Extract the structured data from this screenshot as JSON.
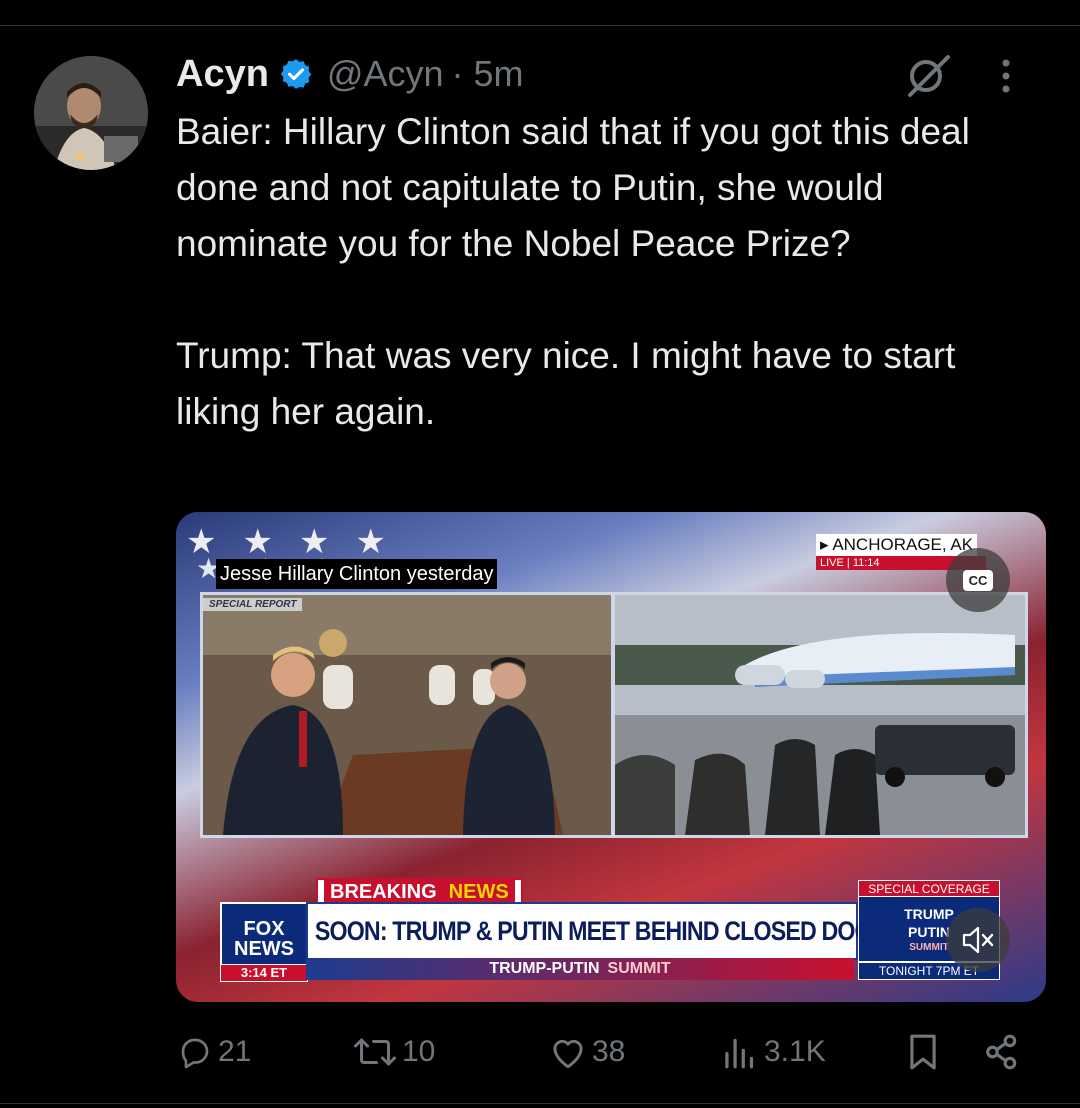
{
  "tweet": {
    "display_name": "Acyn",
    "handle": "@Acyn",
    "time": "· 5m",
    "text": "Baier: Hillary Clinton said that if you got this deal done and not capitulate to Putin, she would nominate you for the Nobel Peace Prize?\n\nTrump: That was very nice. I might have to start liking her again."
  },
  "media": {
    "caption": "Jesse Hillary Clinton yesterday",
    "special_report_tag": "SPECIAL REPORT",
    "location": "▸ ANCHORAGE, AK",
    "live": "LIVE  |  11:14",
    "cc_label": "CC",
    "breaking_1": "BREAKING",
    "breaking_2": "NEWS",
    "headline": "SOON: TRUMP & PUTIN MEET BEHIND CLOSED DOORS",
    "sub_1": "TRUMP-PUTIN",
    "sub_2": "SUMMIT",
    "fox_1": "FOX",
    "fox_2": "NEWS",
    "clock": "3:14 ET",
    "special_coverage": "SPECIAL COVERAGE",
    "summit_1": "TRUMP",
    "summit_2": "PUTIN",
    "summit_3": "SUMMIT",
    "tonight": "TONIGHT 7PM ET"
  },
  "metrics": {
    "replies": "21",
    "reposts": "10",
    "likes": "38",
    "views": "3.1K"
  },
  "icons": [
    "verified-badge-icon",
    "grok-icon",
    "more-icon",
    "reply-icon",
    "repost-icon",
    "like-icon",
    "views-icon",
    "bookmark-icon",
    "share-icon",
    "cc-icon",
    "mute-icon"
  ],
  "colors": {
    "background": "#000000",
    "text": "#e7e9ea",
    "secondary": "#71767b",
    "verified": "#1d9bf0"
  }
}
